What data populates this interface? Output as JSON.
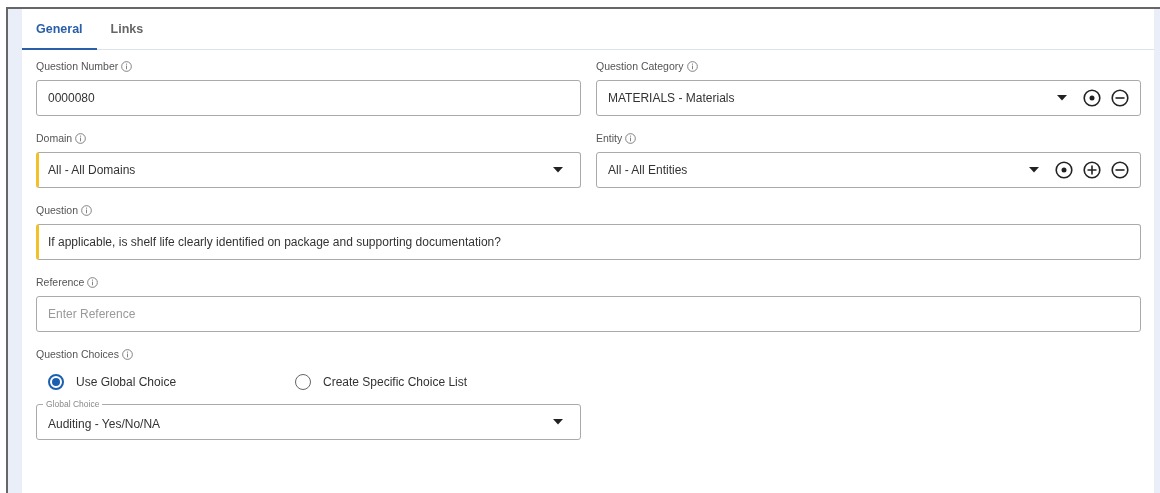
{
  "tabs": [
    {
      "label": "General",
      "selected": true
    },
    {
      "label": "Links",
      "selected": false
    }
  ],
  "fields": [
    {
      "label": "Question Number",
      "kind": "text",
      "value": "0000080",
      "required": false,
      "full_width": false
    },
    {
      "label": "Question Category",
      "kind": "select",
      "value": "MATERIALS - Materials",
      "required": false,
      "full_width": false,
      "actions": [
        {
          "kind": "target"
        },
        {
          "kind": "remove"
        }
      ]
    },
    {
      "label": "Domain",
      "kind": "select",
      "value": "All - All Domains",
      "required": true,
      "full_width": false
    },
    {
      "label": "Entity",
      "kind": "select",
      "value": "All - All Entities",
      "required": false,
      "full_width": false,
      "actions": [
        {
          "kind": "target"
        },
        {
          "kind": "add"
        },
        {
          "kind": "remove"
        }
      ]
    },
    {
      "label": "Question",
      "kind": "text",
      "value": "If applicable, is shelf life clearly identified on package and supporting documentation?",
      "required": true,
      "full_width": true
    },
    {
      "label": "Reference",
      "kind": "text",
      "placeholder": "Enter Reference",
      "required": false,
      "full_width": true
    }
  ],
  "question_choices": {
    "label": "Question Choices",
    "options": [
      {
        "label": "Use Global Choice",
        "selected": true
      },
      {
        "label": "Create Specific Choice List",
        "selected": false
      }
    ],
    "global_choice": {
      "label": "Global Choice",
      "value": "Auditing - Yes/No/NA"
    }
  }
}
